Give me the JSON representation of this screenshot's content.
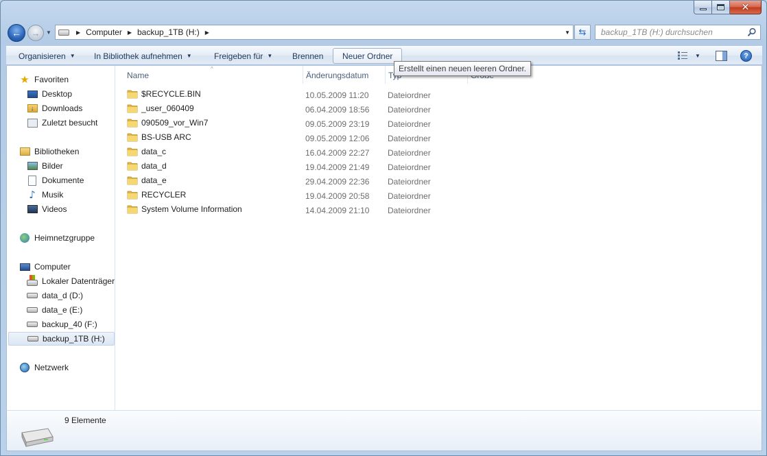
{
  "window": {
    "caption_buttons": [
      "minimize-icon",
      "maximize-icon",
      "close-icon"
    ]
  },
  "address": {
    "breadcrumbs": [
      "Computer",
      "backup_1TB (H:)"
    ],
    "search_placeholder": "backup_1TB (H:) durchsuchen"
  },
  "toolbar": {
    "organize": "Organisieren",
    "library": "In Bibliothek aufnehmen",
    "share": "Freigeben für",
    "burn": "Brennen",
    "new_folder": "Neuer Ordner",
    "tooltip": "Erstellt einen neuen leeren Ordner."
  },
  "nav": {
    "favorites": {
      "label": "Favoriten",
      "items": [
        "Desktop",
        "Downloads",
        "Zuletzt besucht"
      ]
    },
    "libraries": {
      "label": "Bibliotheken",
      "items": [
        "Bilder",
        "Dokumente",
        "Musik",
        "Videos"
      ]
    },
    "homegroup": {
      "label": "Heimnetzgruppe"
    },
    "computer": {
      "label": "Computer",
      "items": [
        "Lokaler Datenträger",
        "data_d (D:)",
        "data_e (E:)",
        "backup_40 (F:)",
        "backup_1TB (H:)"
      ],
      "selected": "backup_1TB (H:)"
    },
    "network": {
      "label": "Netzwerk"
    }
  },
  "columns": {
    "name": "Name",
    "date": "Änderungsdatum",
    "type": "Typ",
    "size": "Größe"
  },
  "files": [
    {
      "name": "$RECYCLE.BIN",
      "date": "10.05.2009 11:20",
      "type": "Dateiordner"
    },
    {
      "name": "_user_060409",
      "date": "06.04.2009 18:56",
      "type": "Dateiordner"
    },
    {
      "name": "090509_vor_Win7",
      "date": "09.05.2009 23:19",
      "type": "Dateiordner"
    },
    {
      "name": "BS-USB ARC",
      "date": "09.05.2009 12:06",
      "type": "Dateiordner"
    },
    {
      "name": "data_c",
      "date": "16.04.2009 22:27",
      "type": "Dateiordner"
    },
    {
      "name": "data_d",
      "date": "19.04.2009 21:49",
      "type": "Dateiordner"
    },
    {
      "name": "data_e",
      "date": "29.04.2009 22:36",
      "type": "Dateiordner"
    },
    {
      "name": "RECYCLER",
      "date": "19.04.2009 20:58",
      "type": "Dateiordner"
    },
    {
      "name": "System Volume Information",
      "date": "14.04.2009 21:10",
      "type": "Dateiordner"
    }
  ],
  "details": {
    "count": "9 Elemente"
  }
}
